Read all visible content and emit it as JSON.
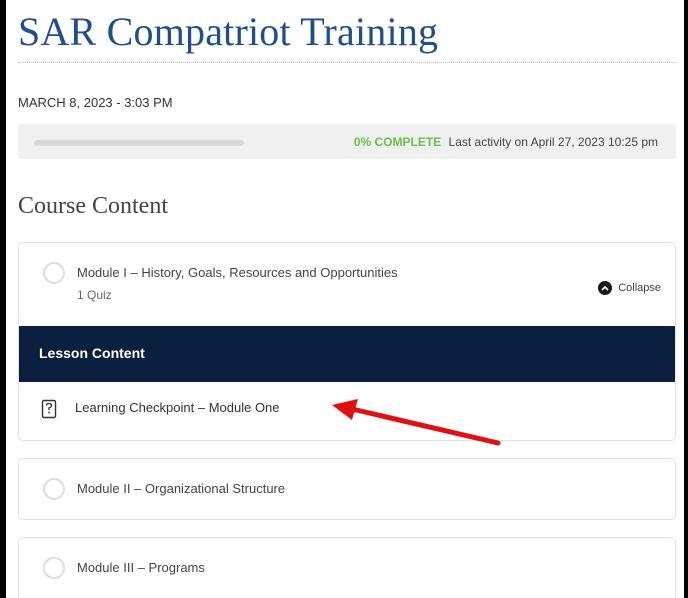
{
  "course": {
    "title": "SAR Compatriot Training",
    "date": "MARCH 8, 2023 - 3:03 PM",
    "progress_percent": 0,
    "progress_label": "0% COMPLETE",
    "last_activity": "Last activity on April 27, 2023 10:25 pm",
    "content_heading": "Course Content"
  },
  "modules": [
    {
      "title": "Module I – History, Goals, Resources and Opportunities",
      "subtitle": "1 Quiz",
      "toggle_label": "Collapse",
      "lesson_content_label": "Lesson Content",
      "lessons": [
        {
          "title": "Learning Checkpoint – Module One"
        }
      ]
    },
    {
      "title": "Module II – Organizational Structure"
    },
    {
      "title": "Module III – Programs"
    }
  ],
  "colors": {
    "title": "#1f4e8c",
    "progress_accent": "#6cc04a",
    "lesson_bar": "#0b1f3f",
    "annotation_arrow": "#e01010"
  },
  "icons": [
    "status-circle-icon",
    "chevron-up-icon",
    "quiz-icon",
    "annotation-arrow-icon"
  ]
}
